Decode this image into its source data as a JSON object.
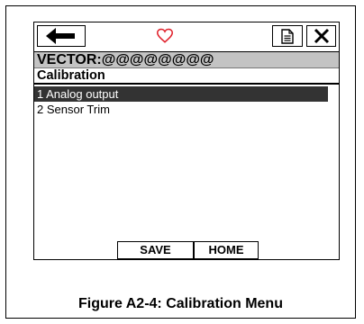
{
  "device": {
    "toolbar": {
      "back_icon": "back-arrow-icon",
      "favorite_icon": "heart-outline-icon",
      "favorite_color": "#e0202a",
      "doc_icon": "document-icon",
      "close_icon": "close-x-icon"
    },
    "title": "VECTOR:@@@@@@@@",
    "menu_title": "Calibration",
    "menu_items": [
      {
        "label": "1 Analog output",
        "selected": true
      },
      {
        "label": "2 Sensor Trim",
        "selected": false
      }
    ],
    "buttons": {
      "save": "SAVE",
      "home": "HOME"
    }
  },
  "caption": "Figure A2-4:  Calibration Menu"
}
